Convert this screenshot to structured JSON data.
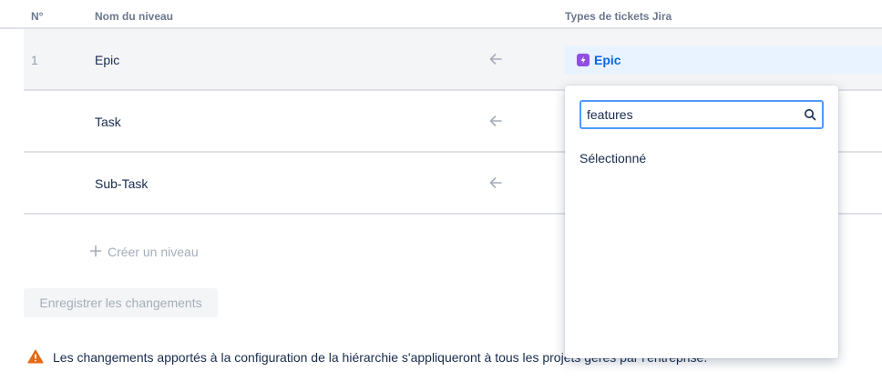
{
  "table": {
    "headers": {
      "num": "N°",
      "name": "Nom du niveau",
      "types": "Types de tickets Jira"
    },
    "rows": [
      {
        "num": "1",
        "name": "Epic",
        "issue_type": "Epic"
      },
      {
        "num": "",
        "name": "Task",
        "issue_type": ""
      },
      {
        "num": "",
        "name": "Sub-Task",
        "issue_type": ""
      }
    ]
  },
  "actions": {
    "create_level": "Créer un niveau",
    "save": "Enregistrer les changements"
  },
  "warning": {
    "text": "Les changements apportés à la configuration de la hiérarchie s'appliqueront à tous les projets gérés par l'entreprise."
  },
  "dropdown": {
    "search_value": "features",
    "selected_heading": "Sélectionné"
  },
  "icons": {
    "arrow": "arrow-left-icon",
    "epic": "lightning-bolt-icon",
    "plus": "plus-icon",
    "warning": "warning-triangle-icon",
    "search": "search-icon"
  },
  "colors": {
    "accent": "#0c66e4",
    "epic_purple": "#904ee2",
    "warning_orange": "#e56910",
    "focus_border": "#4c9aff"
  }
}
